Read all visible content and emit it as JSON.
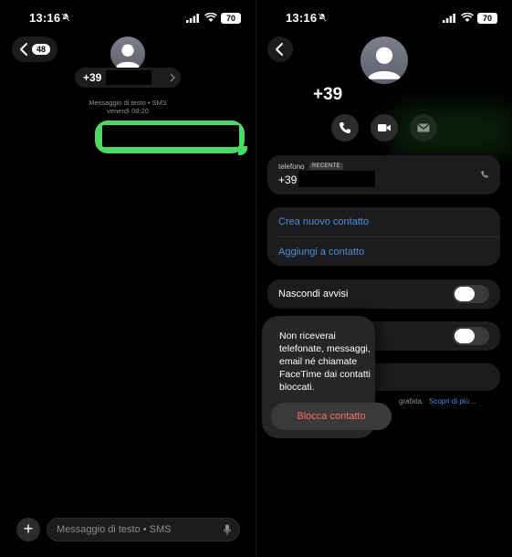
{
  "status_bar": {
    "time": "13:16",
    "battery": "70"
  },
  "left": {
    "back_count": "48",
    "contact_number_prefix": "+39",
    "sms_meta_line1": "Messaggio di testo • SMS",
    "sms_meta_line2": "venerdì 08:20",
    "input_placeholder": "Messaggio di testo • SMS",
    "plus_label": "+"
  },
  "right": {
    "contact_name_prefix": "+39",
    "phone_card": {
      "label": "telefono",
      "tag": "RECENTE",
      "number_prefix": "+39"
    },
    "links": [
      "Crea nuovo contatto",
      "Aggiungi a contatto"
    ],
    "hide_alerts": "Nascondi avvisi",
    "footer_text": "grafata.",
    "footer_link": "Scopri di più…"
  },
  "popover": {
    "message": "Non riceverai telefonate, messaggi, email né chiamate FaceTime dai contatti bloccati.",
    "button": "Blocca contatto"
  },
  "colors": {
    "bubble": "#4cd964",
    "link": "#4a90e2",
    "destructive": "#ff6b6b"
  }
}
